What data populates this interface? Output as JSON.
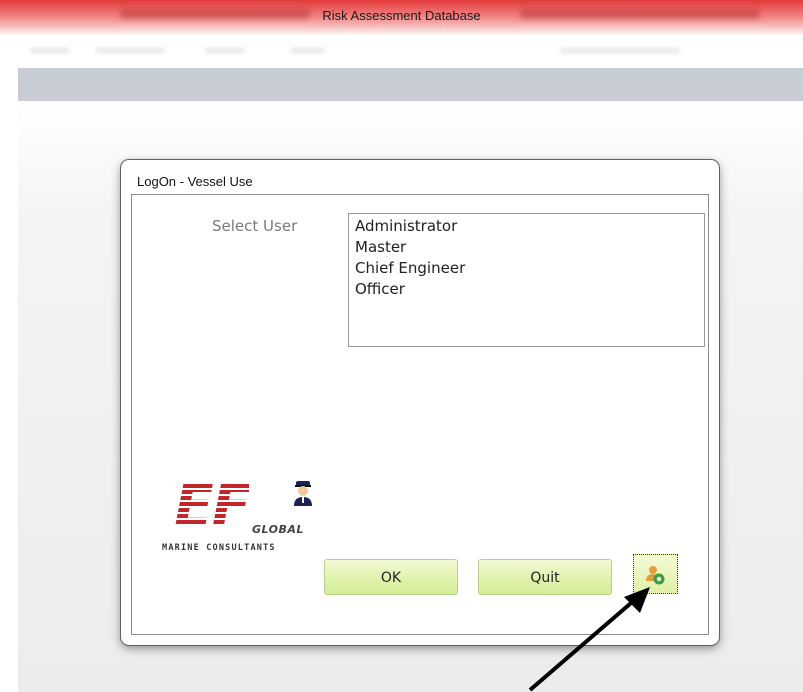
{
  "window": {
    "title": "Risk Assessment Database"
  },
  "dialog": {
    "title": "LogOn - Vessel Use",
    "select_label": "Select User",
    "users": [
      "Administrator",
      "Master",
      "Chief Engineer",
      "Officer"
    ],
    "ok_label": "OK",
    "quit_label": "Quit",
    "user_button_icon": "user-add-icon"
  },
  "logo": {
    "letters": "EF",
    "global": "GLOBAL",
    "tagline": "MARINE CONSULTANTS"
  },
  "colors": {
    "titlebar": "#e23a3a",
    "button_green": "#e2f3b0",
    "logo_red": "#c0262a"
  }
}
